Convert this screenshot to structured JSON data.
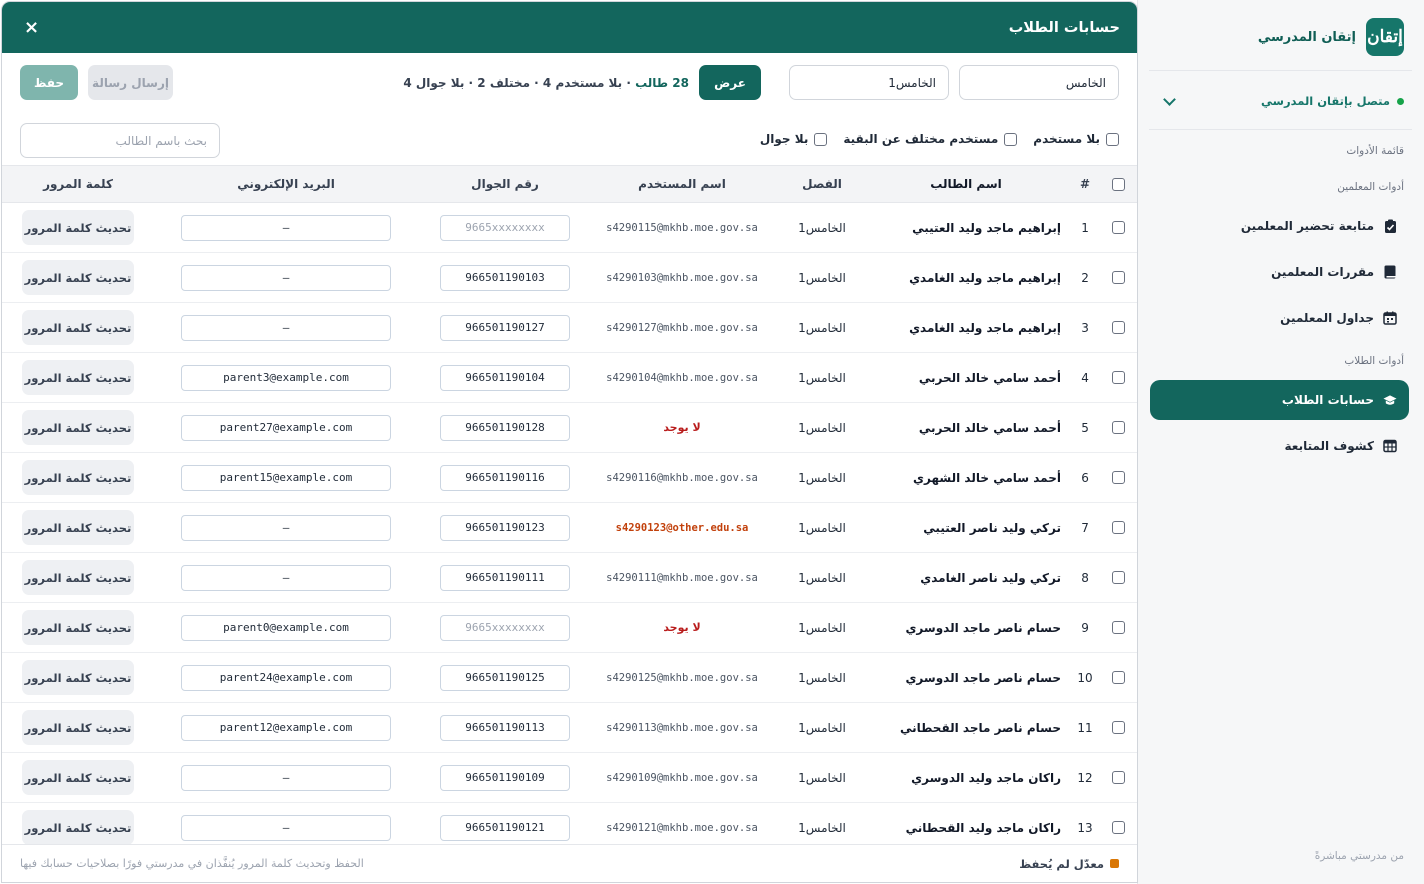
{
  "sidebar": {
    "brand_logo_text": "إتقان",
    "brand_name": "إتقان المدرسي",
    "status": "متصل بإتقان المدرسي",
    "tools_menu_label": "قائمة الأدوات",
    "teacher_tools_label": "أدوات المعلمين",
    "student_tools_label": "أدوات الطلاب",
    "items": [
      {
        "label": "متابعة تحضير المعلمين",
        "icon": "clipboard-check-icon"
      },
      {
        "label": "مقررات المعلمين",
        "icon": "book-icon"
      },
      {
        "label": "جداول المعلمين",
        "icon": "calendar-icon"
      },
      {
        "label": "حسابات الطلاب",
        "icon": "graduation-cap-icon"
      },
      {
        "label": "كشوف المتابعة",
        "icon": "table-icon"
      }
    ],
    "footer": "من مدرستي مباشرةً"
  },
  "modal": {
    "title": "حسابات الطلاب",
    "close": "×",
    "grade_select": "الخامس",
    "class_select": "الخامس1",
    "view_button": "عرض",
    "summary_total": "28 طالب",
    "summary_rest": " · بلا مستخدم 4 · مختلف 2 · بلا جوال 4",
    "send_message_button": "إرسال رسالة",
    "save_button": "حفظ",
    "filter_no_user": "بلا مستخدم",
    "filter_different_user": "مستخدم مختلف عن البقية",
    "filter_no_phone": "بلا جوال",
    "search_placeholder": "بحث باسم الطالب",
    "columns": {
      "index": "#",
      "name": "اسم الطالب",
      "class": "الفصل",
      "username": "اسم المستخدم",
      "phone": "رقم الجوال",
      "email": "البريد الإلكتروني",
      "password": "كلمة المرور"
    },
    "password_button_label": "تحديث كلمة المرور",
    "legend": "معدّل لم يُحفظ",
    "footnote": "الحفظ وتحديث كلمة المرور يُنفَّذان في مدرستي فورًا بصلاحيات حسابك فيها",
    "rows": [
      {
        "index": "1",
        "name": "إبراهيم ماجد وليد العتيبي",
        "class": "الخامس1",
        "username": "s4290115@mkhb.moe.gov.sa",
        "user_state": "normal",
        "phone": "9665xxxxxxxx",
        "phone_placeholder": true,
        "email": "–"
      },
      {
        "index": "2",
        "name": "إبراهيم ماجد وليد الغامدي",
        "class": "الخامس1",
        "username": "s4290103@mkhb.moe.gov.sa",
        "user_state": "normal",
        "phone": "966501190103",
        "phone_placeholder": false,
        "email": "–"
      },
      {
        "index": "3",
        "name": "إبراهيم ماجد وليد الغامدي",
        "class": "الخامس1",
        "username": "s4290127@mkhb.moe.gov.sa",
        "user_state": "normal",
        "phone": "966501190127",
        "phone_placeholder": false,
        "email": "–"
      },
      {
        "index": "4",
        "name": "أحمد سامي خالد الحربي",
        "class": "الخامس1",
        "username": "s4290104@mkhb.moe.gov.sa",
        "user_state": "normal",
        "phone": "966501190104",
        "phone_placeholder": false,
        "email": "parent3@example.com"
      },
      {
        "index": "5",
        "name": "أحمد سامي خالد الحربي",
        "class": "الخامس1",
        "username": "لا يوجد",
        "user_state": "none",
        "phone": "966501190128",
        "phone_placeholder": false,
        "email": "parent27@example.com"
      },
      {
        "index": "6",
        "name": "أحمد سامي خالد الشهري",
        "class": "الخامس1",
        "username": "s4290116@mkhb.moe.gov.sa",
        "user_state": "normal",
        "phone": "966501190116",
        "phone_placeholder": false,
        "email": "parent15@example.com"
      },
      {
        "index": "7",
        "name": "تركي وليد ناصر العتيبي",
        "class": "الخامس1",
        "username": "s4290123@other.edu.sa",
        "user_state": "diff",
        "phone": "966501190123",
        "phone_placeholder": false,
        "email": "–"
      },
      {
        "index": "8",
        "name": "تركي وليد ناصر الغامدي",
        "class": "الخامس1",
        "username": "s4290111@mkhb.moe.gov.sa",
        "user_state": "normal",
        "phone": "966501190111",
        "phone_placeholder": false,
        "email": "–"
      },
      {
        "index": "9",
        "name": "حسام ناصر ماجد الدوسري",
        "class": "الخامس1",
        "username": "لا يوجد",
        "user_state": "none",
        "phone": "9665xxxxxxxx",
        "phone_placeholder": true,
        "email": "parent0@example.com"
      },
      {
        "index": "10",
        "name": "حسام ناصر ماجد الدوسري",
        "class": "الخامس1",
        "username": "s4290125@mkhb.moe.gov.sa",
        "user_state": "normal",
        "phone": "966501190125",
        "phone_placeholder": false,
        "email": "parent24@example.com"
      },
      {
        "index": "11",
        "name": "حسام ناصر ماجد القحطاني",
        "class": "الخامس1",
        "username": "s4290113@mkhb.moe.gov.sa",
        "user_state": "normal",
        "phone": "966501190113",
        "phone_placeholder": false,
        "email": "parent12@example.com"
      },
      {
        "index": "12",
        "name": "راكان ماجد وليد الدوسري",
        "class": "الخامس1",
        "username": "s4290109@mkhb.moe.gov.sa",
        "user_state": "normal",
        "phone": "966501190109",
        "phone_placeholder": false,
        "email": "–"
      },
      {
        "index": "13",
        "name": "راكان ماجد وليد القحطاني",
        "class": "الخامس1",
        "username": "s4290121@mkhb.moe.gov.sa",
        "user_state": "normal",
        "phone": "966501190121",
        "phone_placeholder": false,
        "email": "–"
      }
    ]
  },
  "colors": {
    "primary": "#13665d",
    "status_online": "#16a34a",
    "no_user": "#b91c1c",
    "different_user": "#c2410c",
    "unsaved": "#d97706"
  }
}
